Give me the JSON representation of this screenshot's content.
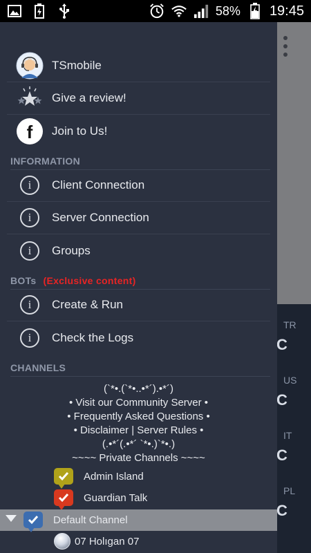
{
  "status_bar": {
    "battery_percent": "58%",
    "time": "19:45",
    "left_icons": [
      "image-icon",
      "battery-charging-icon",
      "usb-icon"
    ],
    "right_icons": [
      "alarm-icon",
      "wifi-icon",
      "signal-icon",
      "battery-icon"
    ]
  },
  "drawer": {
    "profile": {
      "name": "TSmobile"
    },
    "review": {
      "label": "Give a review!"
    },
    "join": {
      "label": "Join to Us!"
    },
    "sections": {
      "information": "INFORMATION",
      "bots": "BOTs",
      "bots_note": "(Exclusive content)",
      "channels": "CHANNELS"
    },
    "information_items": [
      {
        "label": "Client Connection"
      },
      {
        "label": "Server Connection"
      },
      {
        "label": "Groups"
      }
    ],
    "bot_items": [
      {
        "label": "Create & Run"
      },
      {
        "label": "Check the Logs"
      }
    ],
    "channel_text_lines": [
      "(`*•.(`*•..•*´).•*´)",
      "• Visit our Community Server •",
      "• Frequently Asked Questions •",
      "• Disclaimer | Server Rules •",
      "(.•*´(.•*´ `*•.)`*•.)",
      "~~~~ Private Channels ~~~~"
    ],
    "channels": [
      {
        "label": "Admin Island",
        "color": "#b0a21a"
      },
      {
        "label": "Guardian Talk",
        "color": "#d8391f"
      },
      {
        "label": "Default Channel",
        "color": "#3c6db0"
      }
    ],
    "user_in_channel": "07 Holıgan 07"
  },
  "background": {
    "flags": [
      "TR",
      "US",
      "IT",
      "PL"
    ]
  },
  "colors": {
    "drawer_bg": "#2b3140",
    "section_text": "#8f97a8",
    "exclusive_red": "#e82424",
    "selected_row": "#8a8d93"
  }
}
